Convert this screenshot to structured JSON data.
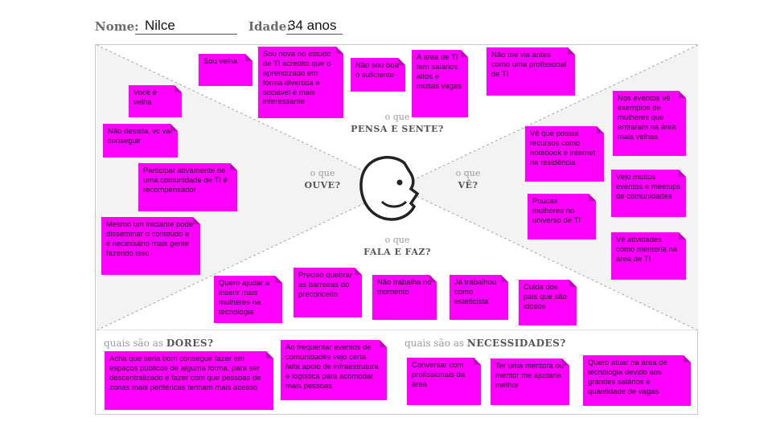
{
  "header": {
    "name_label": "Nome:",
    "name_value": "Nilce",
    "age_label": "Idade:",
    "age_value": "34 anos"
  },
  "quadrants": {
    "pensa": {
      "prefix": "o que",
      "title": "PENSA E SENTE?"
    },
    "ouve": {
      "prefix": "o que",
      "title": "OUVE?"
    },
    "ve": {
      "prefix": "o que",
      "title": "VÊ?"
    },
    "fala": {
      "prefix": "o que",
      "title": "FALA E FAZ?"
    }
  },
  "bottom": {
    "dores": {
      "prefix": "quais são as",
      "title": "DORES?"
    },
    "necessidades": {
      "prefix": "quais são as",
      "title": "NECESSIDADES?"
    }
  },
  "notes": {
    "pensa": [
      "Sou velha",
      "Sou nova no estudo de TI acredito que o aprendizado em forma divertida e sociável é mais interessante",
      "Não sou boa o suficiente",
      "A área de TI tem salários altos e muitas vagas",
      "Não me via antes como uma profissonal de TI"
    ],
    "ouve": [
      "Você é velha",
      "Não desista, vc vai conseguir",
      "Participar ativamente de uma comunidade de TI é recompensador",
      "Mesmo um iniciante pode disseminar o conteúdo e é necessário mais gente fazendo isso"
    ],
    "ve": [
      "Nos eventos vê exemplos de mulheres que entraram na área mais velhas",
      "Vê que possui recursos como notebook e internet na residência",
      "Vejo muitos eventos e meetups de comunidades",
      "Poucas mulheres no universo de TI",
      "Vê atividades como mentoria na área de TI"
    ],
    "fala": [
      "Quero ajudar a inserir mais mulheres na tecnologia",
      "Preciso quebrar as barreiras do preconceito",
      "Não trabalha no momento",
      "Já trabalhou como esteticista",
      "Cuida dos pais que são idosos"
    ],
    "dores": [
      "Acha que seria bom conseguir fazer em espaços públicos de alguma forma, para ser descentralizado e fazer com que pessoas de zonas mais periféricas tenham mais acesso",
      "Ao frequentar eventos de comunidades vejo certa falta apoio de infraestrutura e logística para acomodar mais pessoas"
    ],
    "necessidades": [
      "Conversar com profissionais da área",
      "Ter uma mentora ou mentor me ajudaria melhor",
      "Quero atuar na área de tecnologia devido aos grandes salários e quantidade de vagas"
    ]
  },
  "colors": {
    "note": "#ff00ff",
    "fold": "#c000c0",
    "border": "#c8c8c8"
  }
}
